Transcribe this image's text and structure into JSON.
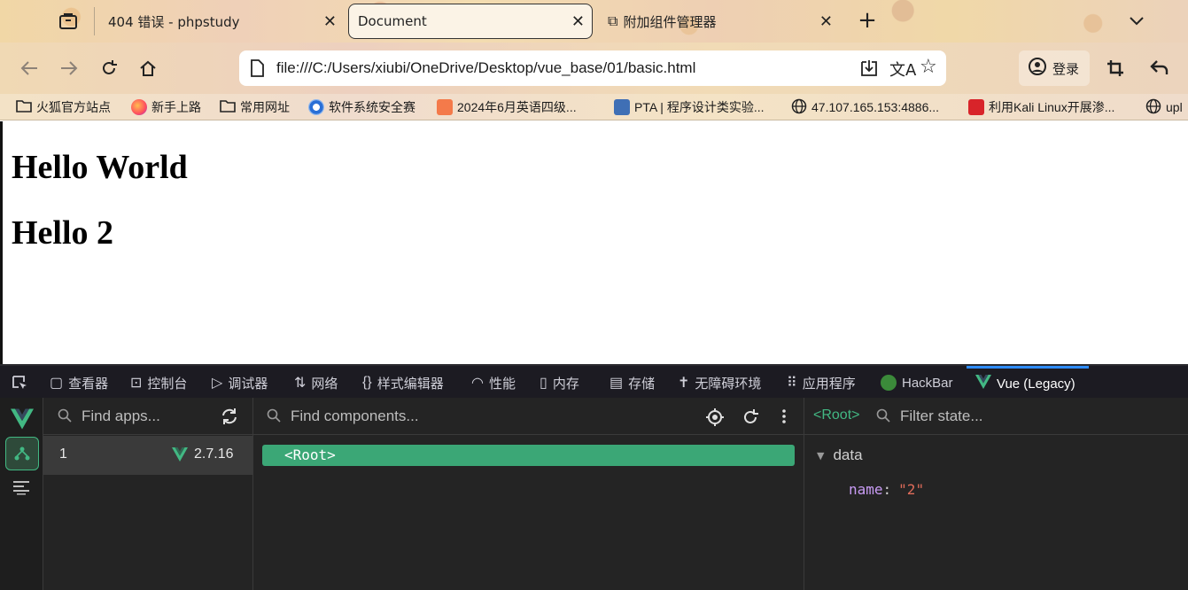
{
  "tabs": [
    {
      "label": "404 错误 - phpstudy",
      "close": "✕"
    },
    {
      "label": "Document",
      "close": "✕"
    },
    {
      "label": "附加组件管理器",
      "close": "✕"
    }
  ],
  "new_tab": "+",
  "url": "file:///C:/Users/xiubi/OneDrive/Desktop/vue_base/01/basic.html",
  "account": {
    "label": "登录"
  },
  "bookmarks": [
    {
      "label": "火狐官方站点"
    },
    {
      "label": "新手上路"
    },
    {
      "label": "常用网址"
    },
    {
      "label": "软件系统安全赛"
    },
    {
      "label": "2024年6月英语四级..."
    },
    {
      "label": "PTA | 程序设计类实验..."
    },
    {
      "label": "47.107.165.153:4886..."
    },
    {
      "label": "利用Kali Linux开展渗..."
    },
    {
      "label": "upl"
    }
  ],
  "page": {
    "h1_first": "Hello World",
    "h1_second": "Hello 2"
  },
  "devtools": {
    "tabs": [
      "查看器",
      "控制台",
      "调试器",
      "网络",
      "样式编辑器",
      "性能",
      "内存",
      "存储",
      "无障碍环境",
      "应用程序",
      "HackBar",
      "Vue (Legacy)"
    ],
    "apps": {
      "search_placeholder": "Find apps...",
      "rows": [
        {
          "id": "1",
          "version": "2.7.16"
        }
      ]
    },
    "components": {
      "search_placeholder": "Find components...",
      "root": "<Root>"
    },
    "state": {
      "selected": "<Root>",
      "filter_placeholder": "Filter state...",
      "section": "data",
      "entries": [
        {
          "key": "name",
          "value": "\"2\""
        }
      ]
    }
  },
  "colors": {
    "vue_green": "#42b883",
    "selected_row": "#3ba776",
    "string_value": "#e06c5a",
    "key_purple": "#c99cf5"
  }
}
